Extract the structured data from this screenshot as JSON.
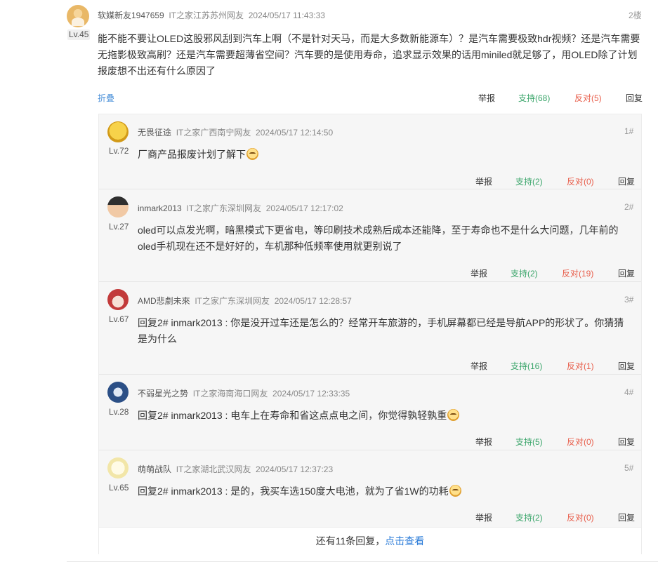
{
  "main_comment": {
    "username": "软媒新友1947659",
    "source": "IT之家江苏苏州网友",
    "time": "2024/05/17 11:43:33",
    "floor": "2楼",
    "level": "Lv.45",
    "content": "能不能不要让OLED这股邪风刮到汽车上啊（不是针对天马，而是大多数新能源车）？是汽车需要极致hdr视频？还是汽车需要无拖影极致高刷？还是汽车需要超薄省空间？汽车要的是使用寿命，追求显示效果的话用miniled就足够了，用OLED除了计划报废想不出还有什么原因了",
    "fold": "折叠",
    "actions": {
      "report": "举报",
      "support": "支持(68)",
      "oppose": "反对(5)",
      "reply": "回复"
    }
  },
  "replies": [
    {
      "username": "无畏征途",
      "source": "IT之家广西南宁网友",
      "time": "2024/05/17 12:14:50",
      "floor": "1#",
      "level": "Lv.72",
      "lines": [
        "厂商产品报废计划了解下"
      ],
      "emoji": "laugh-emoji",
      "actions": {
        "report": "举报",
        "support": "支持(2)",
        "oppose": "反对(0)",
        "reply": "回复"
      }
    },
    {
      "username": "inmark2013",
      "source": "IT之家广东深圳网友",
      "time": "2024/05/17 12:17:02",
      "floor": "2#",
      "level": "Lv.27",
      "lines": [
        "oled可以点发光啊，暗黑模式下更省电，等印刷技术成熟后成本还能降，至于寿命也不是什么大问题，几年前的",
        "oled手机现在还不是好好的，车机那种低频率使用就更别说了"
      ],
      "emoji": "",
      "actions": {
        "report": "举报",
        "support": "支持(2)",
        "oppose": "反对(19)",
        "reply": "回复"
      }
    },
    {
      "username": "AMD悲劇未來",
      "source": "IT之家广东深圳网友",
      "time": "2024/05/17 12:28:57",
      "floor": "3#",
      "level": "Lv.67",
      "lines": [
        "回复2# inmark2013 : 你是没开过车还是怎么的？经常开车旅游的，手机屏幕都已经是导航APP的形状了。你猜猜",
        "是为什么"
      ],
      "emoji": "",
      "actions": {
        "report": "举报",
        "support": "支持(16)",
        "oppose": "反对(1)",
        "reply": "回复"
      }
    },
    {
      "username": "不弱星光之势",
      "source": "IT之家海南海口网友",
      "time": "2024/05/17 12:33:35",
      "floor": "4#",
      "level": "Lv.28",
      "lines": [
        "回复2# inmark2013 : 电车上在寿命和省这点点电之间，你觉得孰轻孰重"
      ],
      "emoji": "thinking-emoji",
      "actions": {
        "report": "举报",
        "support": "支持(5)",
        "oppose": "反对(0)",
        "reply": "回复"
      }
    },
    {
      "username": "萌萌战队",
      "source": "IT之家湖北武汉网友",
      "time": "2024/05/17 12:37:23",
      "floor": "5#",
      "level": "Lv.65",
      "lines": [
        "回复2# inmark2013 : 是的，我买车选150度大电池，就为了省1W的功耗"
      ],
      "emoji": "smile-emoji",
      "actions": {
        "report": "举报",
        "support": "支持(2)",
        "oppose": "反对(0)",
        "reply": "回复"
      }
    }
  ],
  "more_replies": {
    "text": "还有11条回复，",
    "link": "点击查看"
  },
  "colors": {
    "support": "#3aa56a",
    "oppose": "#e85d4a",
    "link": "#2a7bd8"
  }
}
